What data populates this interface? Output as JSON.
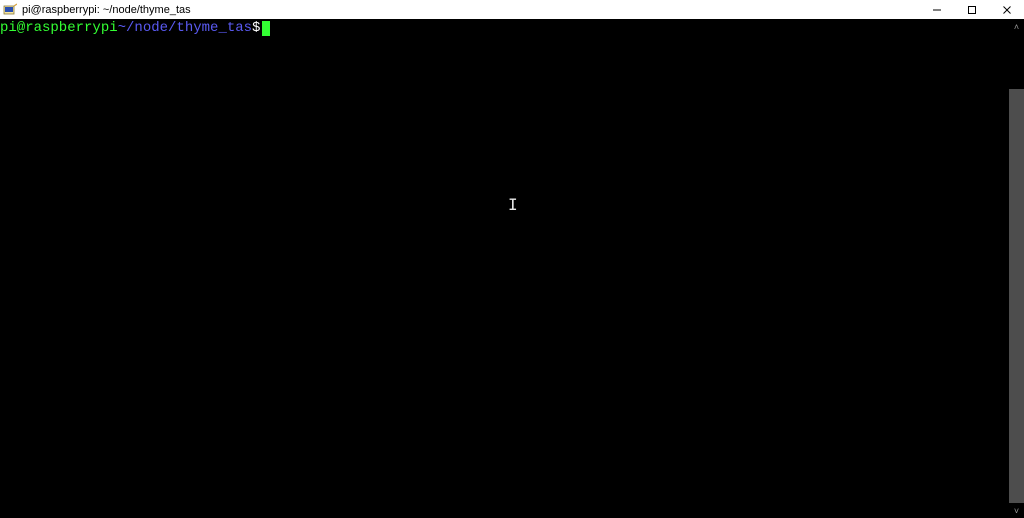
{
  "window": {
    "title": "pi@raspberrypi: ~/node/thyme_tas"
  },
  "controls": {
    "minimize": "—",
    "maximize": "▢",
    "close": "✕"
  },
  "prompt": {
    "user_host": "pi@raspberrypi",
    "separator1": " ",
    "path": "~/node/thyme_tas",
    "separator2": " $ "
  },
  "scrollbar": {
    "up": "˄",
    "down": "˅"
  },
  "caret_glyph": "I"
}
